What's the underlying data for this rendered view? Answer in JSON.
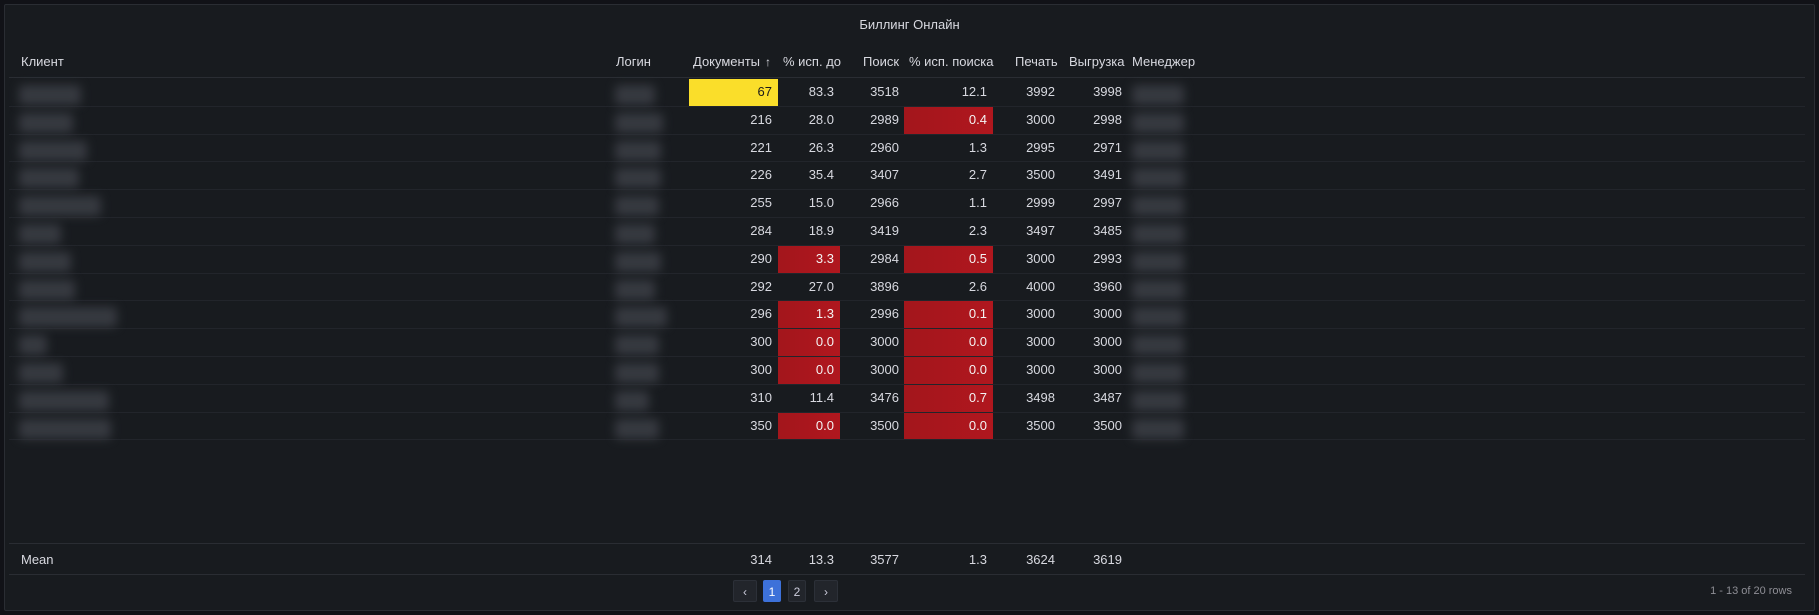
{
  "panel": {
    "title": "Биллинг Онлайн"
  },
  "table": {
    "columns": [
      {
        "label": "Клиент"
      },
      {
        "label": "Логин"
      },
      {
        "label": "Документы",
        "sort": "asc",
        "sort_icon": "arrow-up-icon"
      },
      {
        "label": "% исп. до"
      },
      {
        "label": "Поиск"
      },
      {
        "label": "% исп. поиска"
      },
      {
        "label": "Печать"
      },
      {
        "label": "Выгрузка"
      },
      {
        "label": "Менеджер"
      }
    ],
    "rows": [
      {
        "docs": "67",
        "docs_pct": "83.3",
        "search": "3518",
        "search_pct": "12.1",
        "print": "3992",
        "export": "3998",
        "docs_color": "yellow",
        "docs_pct_color": "",
        "search_pct_color": ""
      },
      {
        "docs": "216",
        "docs_pct": "28.0",
        "search": "2989",
        "search_pct": "0.4",
        "print": "3000",
        "export": "2998",
        "docs_color": "",
        "docs_pct_color": "",
        "search_pct_color": "red"
      },
      {
        "docs": "221",
        "docs_pct": "26.3",
        "search": "2960",
        "search_pct": "1.3",
        "print": "2995",
        "export": "2971",
        "docs_color": "",
        "docs_pct_color": "",
        "search_pct_color": ""
      },
      {
        "docs": "226",
        "docs_pct": "35.4",
        "search": "3407",
        "search_pct": "2.7",
        "print": "3500",
        "export": "3491",
        "docs_color": "",
        "docs_pct_color": "",
        "search_pct_color": ""
      },
      {
        "docs": "255",
        "docs_pct": "15.0",
        "search": "2966",
        "search_pct": "1.1",
        "print": "2999",
        "export": "2997",
        "docs_color": "",
        "docs_pct_color": "",
        "search_pct_color": ""
      },
      {
        "docs": "284",
        "docs_pct": "18.9",
        "search": "3419",
        "search_pct": "2.3",
        "print": "3497",
        "export": "3485",
        "docs_color": "",
        "docs_pct_color": "",
        "search_pct_color": ""
      },
      {
        "docs": "290",
        "docs_pct": "3.3",
        "search": "2984",
        "search_pct": "0.5",
        "print": "3000",
        "export": "2993",
        "docs_color": "",
        "docs_pct_color": "red",
        "search_pct_color": "red"
      },
      {
        "docs": "292",
        "docs_pct": "27.0",
        "search": "3896",
        "search_pct": "2.6",
        "print": "4000",
        "export": "3960",
        "docs_color": "",
        "docs_pct_color": "",
        "search_pct_color": ""
      },
      {
        "docs": "296",
        "docs_pct": "1.3",
        "search": "2996",
        "search_pct": "0.1",
        "print": "3000",
        "export": "3000",
        "docs_color": "",
        "docs_pct_color": "red",
        "search_pct_color": "red"
      },
      {
        "docs": "300",
        "docs_pct": "0.0",
        "search": "3000",
        "search_pct": "0.0",
        "print": "3000",
        "export": "3000",
        "docs_color": "",
        "docs_pct_color": "red",
        "search_pct_color": "red"
      },
      {
        "docs": "300",
        "docs_pct": "0.0",
        "search": "3000",
        "search_pct": "0.0",
        "print": "3000",
        "export": "3000",
        "docs_color": "",
        "docs_pct_color": "red",
        "search_pct_color": "red"
      },
      {
        "docs": "310",
        "docs_pct": "11.4",
        "search": "3476",
        "search_pct": "0.7",
        "print": "3498",
        "export": "3487",
        "docs_color": "",
        "docs_pct_color": "",
        "search_pct_color": "red"
      },
      {
        "docs": "350",
        "docs_pct": "0.0",
        "search": "3500",
        "search_pct": "0.0",
        "print": "3500",
        "export": "3500",
        "docs_color": "",
        "docs_pct_color": "red",
        "search_pct_color": "red"
      }
    ],
    "footer": {
      "label": "Mean",
      "docs": "314",
      "docs_pct": "13.3",
      "search": "3577",
      "search_pct": "1.3",
      "print": "3624",
      "export": "3619"
    }
  },
  "pagination": {
    "prev_icon": "chevron-left-icon",
    "next_icon": "chevron-right-icon",
    "prev_glyph": "‹",
    "next_glyph": "›",
    "pages": [
      "1",
      "2"
    ],
    "active_page": "1",
    "summary": "1 - 13 of 20 rows"
  },
  "colors": {
    "background": "#181b1f",
    "red": "#a3161c",
    "yellow": "#fade2a",
    "accent": "#3d71d9"
  }
}
